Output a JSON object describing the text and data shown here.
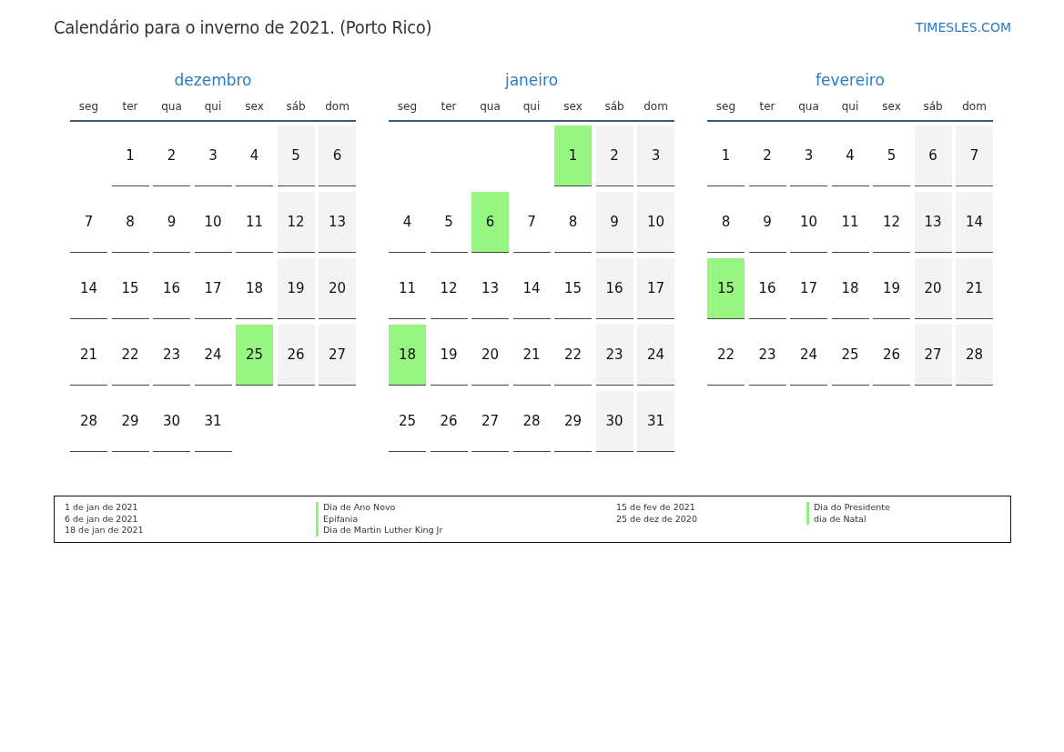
{
  "title": "Calendário para o inverno de 2021. (Porto Rico)",
  "brand": "TIMESLES.COM",
  "months": [
    {
      "name": "dezembro",
      "weekdays": [
        "seg",
        "ter",
        "qua",
        "qui",
        "sex",
        "sáb",
        "dom"
      ],
      "weeks": [
        {
          "kind": "leading",
          "days": [
            {
              "day": "1",
              "kind": "weekday"
            },
            {
              "day": "2",
              "kind": "weekday"
            },
            {
              "day": "3",
              "kind": "weekday"
            },
            {
              "day": "4",
              "kind": "weekday"
            },
            {
              "day": "5",
              "kind": "weekend"
            },
            {
              "day": "6",
              "kind": "weekend"
            }
          ]
        },
        {
          "kind": "full",
          "days": [
            {
              "day": "7",
              "kind": "weekday"
            },
            {
              "day": "8",
              "kind": "weekday"
            },
            {
              "day": "9",
              "kind": "weekday"
            },
            {
              "day": "10",
              "kind": "weekday"
            },
            {
              "day": "11",
              "kind": "weekday"
            },
            {
              "day": "12",
              "kind": "weekend"
            },
            {
              "day": "13",
              "kind": "weekend"
            }
          ]
        },
        {
          "kind": "full",
          "days": [
            {
              "day": "14",
              "kind": "weekday"
            },
            {
              "day": "15",
              "kind": "weekday"
            },
            {
              "day": "16",
              "kind": "weekday"
            },
            {
              "day": "17",
              "kind": "weekday"
            },
            {
              "day": "18",
              "kind": "weekday"
            },
            {
              "day": "19",
              "kind": "weekend"
            },
            {
              "day": "20",
              "kind": "weekend"
            }
          ]
        },
        {
          "kind": "full",
          "days": [
            {
              "day": "21",
              "kind": "weekday"
            },
            {
              "day": "22",
              "kind": "weekday"
            },
            {
              "day": "23",
              "kind": "weekday"
            },
            {
              "day": "24",
              "kind": "weekday"
            },
            {
              "day": "25",
              "kind": "holiday"
            },
            {
              "day": "26",
              "kind": "weekend"
            },
            {
              "day": "27",
              "kind": "weekend"
            }
          ]
        },
        {
          "kind": "trailing",
          "days": [
            {
              "day": "28",
              "kind": "weekday"
            },
            {
              "day": "29",
              "kind": "weekday"
            },
            {
              "day": "30",
              "kind": "weekday"
            },
            {
              "day": "31",
              "kind": "weekday"
            }
          ]
        }
      ]
    },
    {
      "name": "janeiro",
      "weekdays": [
        "seg",
        "ter",
        "qua",
        "qui",
        "sex",
        "sáb",
        "dom"
      ],
      "weeks": [
        {
          "kind": "leading",
          "days": [
            {
              "day": "1",
              "kind": "holiday"
            },
            {
              "day": "2",
              "kind": "weekend"
            },
            {
              "day": "3",
              "kind": "weekend"
            }
          ]
        },
        {
          "kind": "full",
          "days": [
            {
              "day": "4",
              "kind": "weekday"
            },
            {
              "day": "5",
              "kind": "weekday"
            },
            {
              "day": "6",
              "kind": "holiday"
            },
            {
              "day": "7",
              "kind": "weekday"
            },
            {
              "day": "8",
              "kind": "weekday"
            },
            {
              "day": "9",
              "kind": "weekend"
            },
            {
              "day": "10",
              "kind": "weekend"
            }
          ]
        },
        {
          "kind": "full",
          "days": [
            {
              "day": "11",
              "kind": "weekday"
            },
            {
              "day": "12",
              "kind": "weekday"
            },
            {
              "day": "13",
              "kind": "weekday"
            },
            {
              "day": "14",
              "kind": "weekday"
            },
            {
              "day": "15",
              "kind": "weekday"
            },
            {
              "day": "16",
              "kind": "weekend"
            },
            {
              "day": "17",
              "kind": "weekend"
            }
          ]
        },
        {
          "kind": "full",
          "days": [
            {
              "day": "18",
              "kind": "holiday"
            },
            {
              "day": "19",
              "kind": "weekday"
            },
            {
              "day": "20",
              "kind": "weekday"
            },
            {
              "day": "21",
              "kind": "weekday"
            },
            {
              "day": "22",
              "kind": "weekday"
            },
            {
              "day": "23",
              "kind": "weekend"
            },
            {
              "day": "24",
              "kind": "weekend"
            }
          ]
        },
        {
          "kind": "full",
          "days": [
            {
              "day": "25",
              "kind": "weekday"
            },
            {
              "day": "26",
              "kind": "weekday"
            },
            {
              "day": "27",
              "kind": "weekday"
            },
            {
              "day": "28",
              "kind": "weekday"
            },
            {
              "day": "29",
              "kind": "weekday"
            },
            {
              "day": "30",
              "kind": "weekend"
            },
            {
              "day": "31",
              "kind": "weekend"
            }
          ]
        }
      ]
    },
    {
      "name": "fevereiro",
      "weekdays": [
        "seg",
        "ter",
        "qua",
        "qui",
        "sex",
        "sáb",
        "dom"
      ],
      "weeks": [
        {
          "kind": "full",
          "days": [
            {
              "day": "1",
              "kind": "weekday"
            },
            {
              "day": "2",
              "kind": "weekday"
            },
            {
              "day": "3",
              "kind": "weekday"
            },
            {
              "day": "4",
              "kind": "weekday"
            },
            {
              "day": "5",
              "kind": "weekday"
            },
            {
              "day": "6",
              "kind": "weekend"
            },
            {
              "day": "7",
              "kind": "weekend"
            }
          ]
        },
        {
          "kind": "full",
          "days": [
            {
              "day": "8",
              "kind": "weekday"
            },
            {
              "day": "9",
              "kind": "weekday"
            },
            {
              "day": "10",
              "kind": "weekday"
            },
            {
              "day": "11",
              "kind": "weekday"
            },
            {
              "day": "12",
              "kind": "weekday"
            },
            {
              "day": "13",
              "kind": "weekend"
            },
            {
              "day": "14",
              "kind": "weekend"
            }
          ]
        },
        {
          "kind": "full",
          "days": [
            {
              "day": "15",
              "kind": "holiday"
            },
            {
              "day": "16",
              "kind": "weekday"
            },
            {
              "day": "17",
              "kind": "weekday"
            },
            {
              "day": "18",
              "kind": "weekday"
            },
            {
              "day": "19",
              "kind": "weekday"
            },
            {
              "day": "20",
              "kind": "weekend"
            },
            {
              "day": "21",
              "kind": "weekend"
            }
          ]
        },
        {
          "kind": "full",
          "days": [
            {
              "day": "22",
              "kind": "weekday"
            },
            {
              "day": "23",
              "kind": "weekday"
            },
            {
              "day": "24",
              "kind": "weekday"
            },
            {
              "day": "25",
              "kind": "weekday"
            },
            {
              "day": "26",
              "kind": "weekday"
            },
            {
              "day": "27",
              "kind": "weekend"
            },
            {
              "day": "28",
              "kind": "weekend"
            }
          ]
        }
      ]
    }
  ],
  "legend": [
    [
      {
        "date": "1 de jan de 2021",
        "name": "Dia de Ano Novo",
        "color": "#90f07e"
      },
      {
        "date": "6 de jan de 2021",
        "name": "Epifania",
        "color": "#90f07e"
      },
      {
        "date": "18 de jan de 2021",
        "name": "Dia de Martin Luther King Jr",
        "color": "#90f07e"
      }
    ],
    [
      {
        "date": "15 de fev de 2021",
        "name": "Dia do Presidente",
        "color": "#90f07e"
      },
      {
        "date": "25 de dez de 2020",
        "name": "dia de Natal",
        "color": "#90f07e"
      }
    ]
  ]
}
